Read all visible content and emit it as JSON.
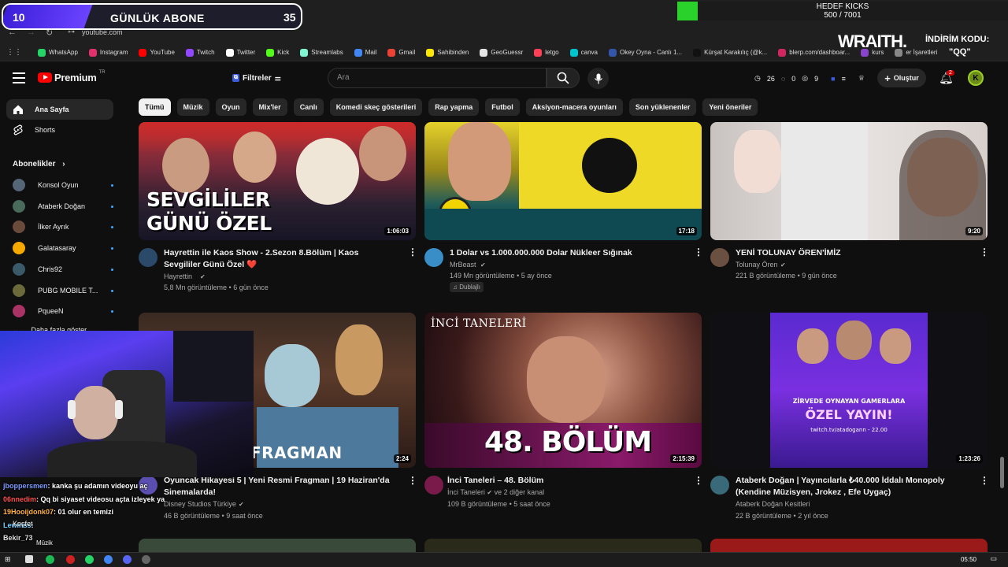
{
  "browser": {
    "url": "youtube.com",
    "bookmarks": [
      {
        "label": "WhatsApp",
        "color": "#25d366"
      },
      {
        "label": "Instagram",
        "color": "#e1306c"
      },
      {
        "label": "YouTube",
        "color": "#ff0000"
      },
      {
        "label": "Twitch",
        "color": "#9146ff"
      },
      {
        "label": "Twitter",
        "color": "#ffffff"
      },
      {
        "label": "Kick",
        "color": "#53fc18"
      },
      {
        "label": "Streamlabs",
        "color": "#80f5d2"
      },
      {
        "label": "Mail",
        "color": "#4285f4"
      },
      {
        "label": "Gmail",
        "color": "#ea4335"
      },
      {
        "label": "Sahibinden",
        "color": "#ffe800"
      },
      {
        "label": "GeoGuessr",
        "color": "#e5e5e5"
      },
      {
        "label": "letgo",
        "color": "#ff3f55"
      },
      {
        "label": "canva",
        "color": "#00c4cc"
      },
      {
        "label": "Okey Oyna - Canlı 1...",
        "color": "#3355aa"
      },
      {
        "label": "Kürşat Karakılıç (@k...",
        "color": "#111111"
      },
      {
        "label": "blerp.com/dashboar...",
        "color": "#d02760"
      },
      {
        "label": "kurs",
        "color": "#8844cc"
      },
      {
        "label": "er İşaretleri",
        "color": "#888888"
      }
    ]
  },
  "overlay": {
    "sub_goal_title": "GÜNLÜK ABONE",
    "sub_current": "10",
    "sub_target": "35",
    "sub_progress": 0.2857,
    "kick_label": "HEDEF KICKS",
    "kick_count": "500 / 7001",
    "sponsor": "WRAITH.",
    "promo_label": "İNDİRİM KODU:",
    "promo_code": "\"QQ\""
  },
  "header": {
    "logo": "Premium",
    "logo_sup": "TR",
    "filters": "Filtreler",
    "search_placeholder": "Ara",
    "stats": [
      "26",
      "0",
      "9"
    ],
    "create": "Oluştur",
    "notifications": "2",
    "avatar_letter": "K"
  },
  "chips": [
    "Tümü",
    "Müzik",
    "Oyun",
    "Mix'ler",
    "Canlı",
    "Komedi skeç gösterileri",
    "Rap yapma",
    "Futbol",
    "Aksiyon-macera oyunları",
    "Son yüklenenler",
    "Yeni öneriler"
  ],
  "sidebar": {
    "home": "Ana Sayfa",
    "shorts": "Shorts",
    "subscriptions_title": "Abonelikler",
    "subscriptions": [
      {
        "name": "Konsol Oyun",
        "color": "#556677"
      },
      {
        "name": "Ataberk Doğan",
        "color": "#4a6a5a"
      },
      {
        "name": "İlker Ayrık",
        "color": "#6a4a3a"
      },
      {
        "name": "Galatasaray",
        "color": "#f5a800"
      },
      {
        "name": "Chris92",
        "color": "#3a5a6a"
      },
      {
        "name": "PUBG MOBILE T...",
        "color": "#6a6a3a"
      },
      {
        "name": "PqueeN",
        "color": "#aa3366"
      }
    ],
    "more": "Daha fazla göster",
    "explore": "Keşfet",
    "music": "Müzik"
  },
  "videos": [
    {
      "title": "Hayrettin ile Kaos Show - 2.Sezon 8.Bölüm | Kaos Sevgililer Günü Özel ❤️",
      "channel": "Hayrettin",
      "views": "5,8 Mn görüntüleme",
      "age": "6 gün önce",
      "duration": "1:06:03",
      "thumb_text": "SEVGİLİLER\nGÜNÜ ÖZEL"
    },
    {
      "title": "1 Dolar vs 1.000.000.000 Dolar Nükleer Sığınak",
      "channel": "MrBeast",
      "views": "149 Mn görüntüleme",
      "age": "5 ay önce",
      "duration": "17:18",
      "badge": "Dublajlı"
    },
    {
      "title": "YENİ TOLUNAY ÖREN'İMİZ",
      "channel": "Tolunay Ören",
      "views": "221 B görüntüleme",
      "age": "9 gün önce",
      "duration": "9:20"
    },
    {
      "title": "Oyuncak Hikayesi 5 | Yeni Resmi Fragman | 19 Haziran'da Sinemalarda!",
      "channel": "Disney Studios Türkiye",
      "views": "46 B görüntüleme",
      "age": "9 saat önce",
      "duration": "2:24",
      "thumb_text": "FRAGMAN"
    },
    {
      "title": "İnci Taneleri – 48. Bölüm",
      "channel": "İnci Taneleri",
      "channel_extra": "ve 2 diğer kanal",
      "views": "109 B görüntüleme",
      "age": "5 saat önce",
      "duration": "2:15:39",
      "thumb_text": "48. BÖLÜM",
      "thumb_logo": "İNCİ TANELERİ"
    },
    {
      "title": "Ataberk Doğan | Yayıncılarla ₺40.000 İddalı Monopoly (Kendine Müzisyen, Jrokez , Efe Uygaç)",
      "channel": "Ataberk Doğan Kesitleri",
      "views": "22 B görüntüleme",
      "age": "2 yıl önce",
      "duration": "1:23:26",
      "thumb_text": "ZİRVEDE OYNAYAN GAMERLARA",
      "thumb_text2": "ÖZEL YAYIN!",
      "thumb_text3": "twitch.tv/atadogann - 22.00"
    }
  ],
  "chat": [
    {
      "user": "jboppersmen",
      "msg": ": kanka şu adamın videoyu aç",
      "color": "#7a9cff"
    },
    {
      "user": "06nnedim",
      "msg": ": Qq bi siyaset videosu açta izleyek ya",
      "color": "#ff4d4d"
    },
    {
      "user": "19Hooijdonk07",
      "msg": ": 01 olur en temizi",
      "color": "#ffb347"
    },
    {
      "user": "Lewinss",
      "msg": ":",
      "color": "#7ad1ff"
    },
    {
      "user": "Bekir_73",
      "msg": "",
      "color": "#dddddd"
    }
  ],
  "taskbar": {
    "time": "05:50"
  }
}
